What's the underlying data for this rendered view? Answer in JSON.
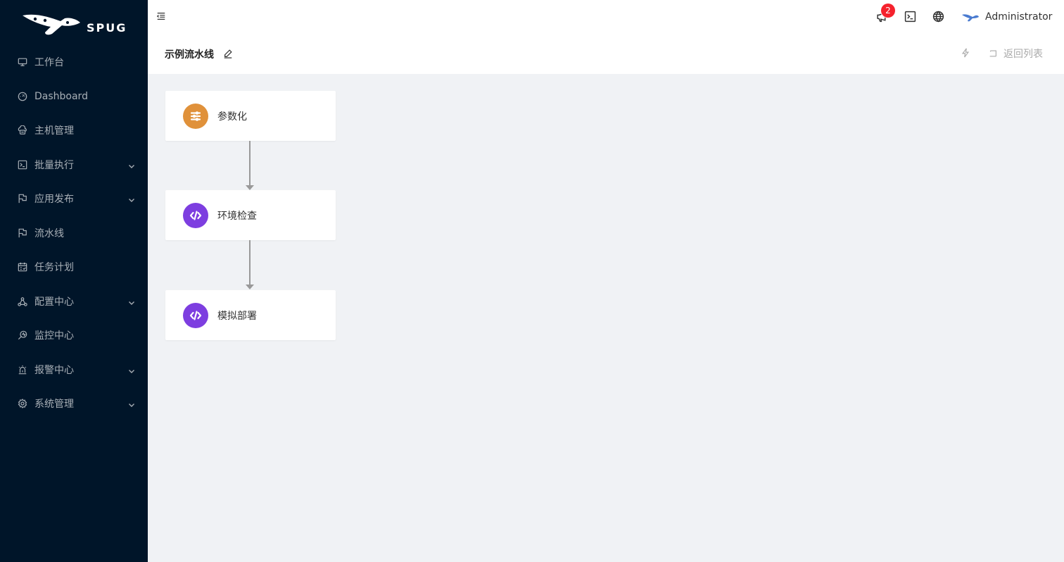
{
  "brand": {
    "name": "SPUG"
  },
  "sidebar": {
    "items": [
      {
        "label": "工作台",
        "icon": "desktop-icon",
        "submenu": false
      },
      {
        "label": "Dashboard",
        "icon": "dashboard-icon",
        "submenu": false
      },
      {
        "label": "主机管理",
        "icon": "cloud-server-icon",
        "submenu": false
      },
      {
        "label": "批量执行",
        "icon": "terminal-icon",
        "submenu": true
      },
      {
        "label": "应用发布",
        "icon": "flag-icon",
        "submenu": true
      },
      {
        "label": "流水线",
        "icon": "flag-icon",
        "submenu": false
      },
      {
        "label": "任务计划",
        "icon": "schedule-icon",
        "submenu": false
      },
      {
        "label": "配置中心",
        "icon": "deployment-icon",
        "submenu": true
      },
      {
        "label": "监控中心",
        "icon": "monitor-icon",
        "submenu": false
      },
      {
        "label": "报警中心",
        "icon": "alert-icon",
        "submenu": true
      },
      {
        "label": "系统管理",
        "icon": "setting-icon",
        "submenu": true
      }
    ]
  },
  "header": {
    "notification_count": "2",
    "user_name": "Administrator"
  },
  "page": {
    "title": "示例流水线",
    "back_label": "返回列表"
  },
  "pipeline": {
    "nodes": [
      {
        "label": "参数化",
        "icon": "sliders-icon",
        "color": "#e0913a"
      },
      {
        "label": "环境检查",
        "icon": "code-icon",
        "color": "#7d3ee0"
      },
      {
        "label": "模拟部署",
        "icon": "code-icon",
        "color": "#7d3ee0"
      }
    ]
  },
  "colors": {
    "sidebar_bg": "#001529",
    "content_bg": "#f0f2f5",
    "badge": "#f5222d"
  }
}
